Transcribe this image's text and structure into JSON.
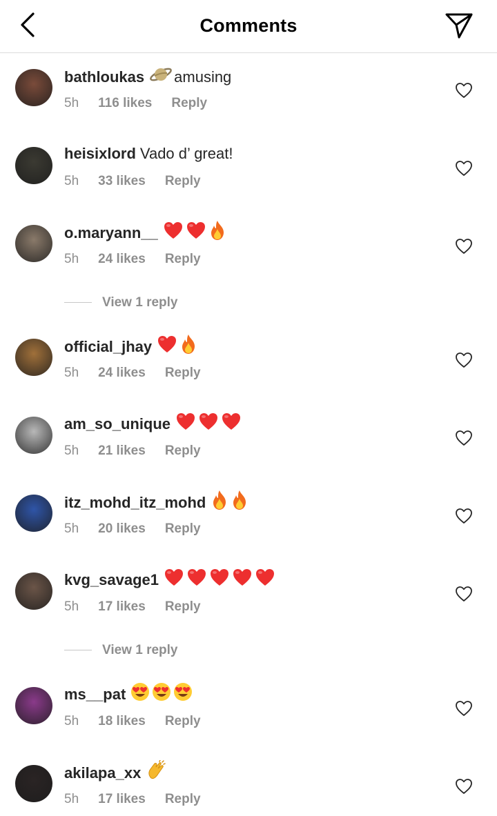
{
  "header": {
    "title": "Comments",
    "back_icon": "chevron-left-icon",
    "share_icon": "paper-plane-icon"
  },
  "comments": [
    {
      "username": "bathloukas",
      "emojis": [
        "saturn"
      ],
      "text": "amusing",
      "time": "5h",
      "likes": "116 likes",
      "reply": "Reply",
      "avatar_color": "#7a4b3a"
    },
    {
      "username": "heisixlord",
      "emojis": [],
      "text": "Vado d’ great!",
      "time": "5h",
      "likes": "33 likes",
      "reply": "Reply",
      "avatar_color": "#3b3a32"
    },
    {
      "username": "o.maryann__",
      "emojis": [
        "heart",
        "heart",
        "fire"
      ],
      "text": "",
      "time": "5h",
      "likes": "24 likes",
      "reply": "Reply",
      "avatar_color": "#8a7a6a",
      "view_replies": "View 1 reply"
    },
    {
      "username": "official_jhay",
      "emojis": [
        "heart",
        "fire"
      ],
      "text": "",
      "time": "5h",
      "likes": "24 likes",
      "reply": "Reply",
      "avatar_color": "#a0703a"
    },
    {
      "username": "am_so_unique",
      "emojis": [
        "heart",
        "heart",
        "heart"
      ],
      "text": "",
      "time": "5h",
      "likes": "21 likes",
      "reply": "Reply",
      "avatar_color": "#b8b8b8"
    },
    {
      "username": "itz_mohd_itz_mohd",
      "emojis": [
        "fire",
        "fire"
      ],
      "text": "",
      "time": "5h",
      "likes": "20 likes",
      "reply": "Reply",
      "avatar_color": "#2f55a8"
    },
    {
      "username": "kvg_savage1",
      "emojis": [
        "heart",
        "heart",
        "heart",
        "heart",
        "heart"
      ],
      "text": "",
      "time": "5h",
      "likes": "17 likes",
      "reply": "Reply",
      "avatar_color": "#6b5548",
      "view_replies": "View 1 reply"
    },
    {
      "username": "ms__pat",
      "emojis": [
        "heart-eyes",
        "heart-eyes",
        "heart-eyes"
      ],
      "text": "",
      "time": "5h",
      "likes": "18 likes",
      "reply": "Reply",
      "avatar_color": "#8a3a8a"
    },
    {
      "username": "akilapa_xx",
      "emojis": [
        "clap"
      ],
      "text": "",
      "time": "5h",
      "likes": "17 likes",
      "reply": "Reply",
      "avatar_color": "#2a2424"
    }
  ],
  "colors": {
    "username": "#262626",
    "meta": "#8e8e8e",
    "heart_red": "#ed2f2f",
    "divider": "#dbdbdb"
  }
}
